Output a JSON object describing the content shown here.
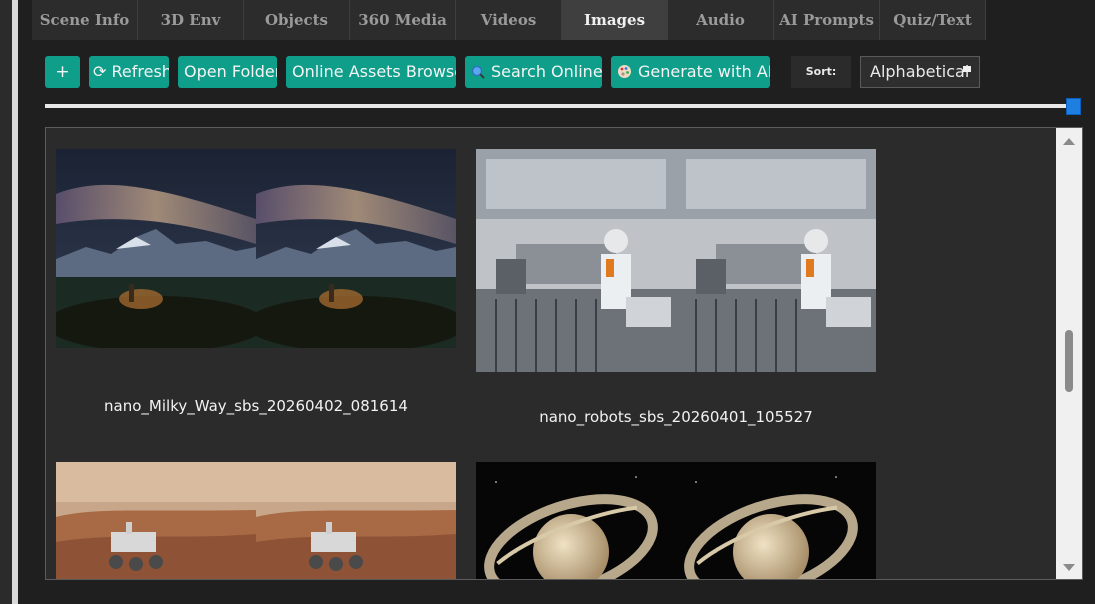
{
  "tabs": [
    {
      "label": "Scene Info"
    },
    {
      "label": "3D Env"
    },
    {
      "label": "Objects"
    },
    {
      "label": "360 Media"
    },
    {
      "label": "Videos"
    },
    {
      "label": "Images",
      "active": true
    },
    {
      "label": "Audio"
    },
    {
      "label": "AI Prompts"
    },
    {
      "label": "Quiz/Text"
    }
  ],
  "toolbar": {
    "add_label": "+",
    "refresh_label": "⟳ Refresh",
    "open_folder_label": "Open Folder",
    "online_assets_label": "Online Assets Browser",
    "search_online_label": "Search Online",
    "generate_ai_label": "Generate with AI",
    "sort_label": "Sort:",
    "sort_value": "Alphabetical"
  },
  "thumbnail_size_slider": {
    "value_fraction": 1.0
  },
  "colors": {
    "accent": "#0e9e8a",
    "slider": "#1e7fe0",
    "active_tab": "#3f3f3f"
  },
  "images": [
    {
      "caption": "nano_Milky_Way_sbs_20260402_081614"
    },
    {
      "caption": "nano_robots_sbs_20260401_105527"
    },
    {
      "caption": ""
    },
    {
      "caption": ""
    }
  ]
}
